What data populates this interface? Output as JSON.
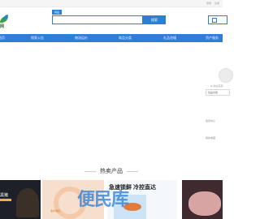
{
  "topbar": {
    "links": [
      "登录",
      "注册"
    ]
  },
  "logo": {
    "text": "网"
  },
  "search": {
    "tag": "商品",
    "placeholder": "",
    "button_label": "搜索"
  },
  "nav": {
    "items": [
      {
        "label": "首页"
      },
      {
        "label": "搜索公告"
      },
      {
        "label": "物流运价"
      },
      {
        "label": "商品分类"
      },
      {
        "label": "礼品池塘"
      },
      {
        "label": "资产服务"
      }
    ]
  },
  "user_panel": {
    "welcome": "Hi,欢迎来到",
    "login_label": "您是访客",
    "info1": "会员中心",
    "info2": "我的收藏"
  },
  "section": {
    "title": "热卖产品"
  },
  "cards": {
    "left_tag": "黑猪",
    "mid_brand": "金米酒店",
    "right_headline": "急速锁鲜 冷控直达"
  },
  "watermark": {
    "text": "便民库",
    "caption": ""
  },
  "colors": {
    "brand": "#2d7fd6",
    "nav_bg": "#2d7fd6"
  }
}
